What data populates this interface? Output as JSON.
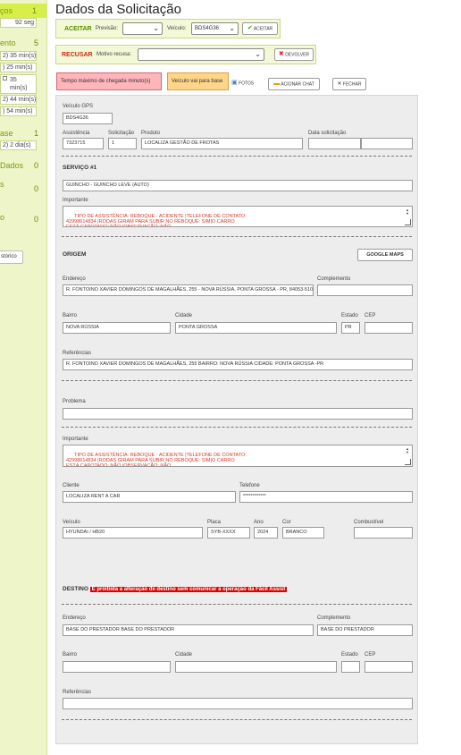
{
  "sidebar": {
    "rows": [
      {
        "title": "ços",
        "num": "1"
      },
      {
        "box": "92 seg"
      },
      {
        "title": "ento",
        "num": "5"
      },
      {
        "box": "2) 35 min(s)"
      },
      {
        "box": ") 25 min(s)"
      },
      {
        "box": "35 min(s)"
      },
      {
        "box": "2) 44 min(s)"
      },
      {
        "box": ") 54 min(s)"
      },
      {
        "title": "ase",
        "num": "1"
      },
      {
        "box": "2) 2 dia(s)"
      },
      {
        "title": "Dados",
        "num": "0"
      },
      {
        "title": "s",
        "num": "0"
      },
      {
        "title": "o",
        "num": "0"
      }
    ],
    "history_button": "stórico"
  },
  "page_title": "Dados da Solicitação",
  "accept_bar": {
    "accept_label": "ACEITAR",
    "forecast_label": "Previsão:",
    "forecast_value": "",
    "vehicle_label": "Veículo:",
    "vehicle_value": "BDS4G36",
    "accept_button": "ACEITAR"
  },
  "refuse_bar": {
    "refuse_label": "RECUSAR",
    "reason_label": "Motivo recusa:",
    "reason_value": "",
    "return_button": "DEVOLVER"
  },
  "tags": {
    "max_time": "Tempo máximo de chegada minuto(s)",
    "vehicle_base": "Veículo vai para base"
  },
  "buttons": {
    "photos": "FOTOS",
    "chat": "ACIONAR CHAT",
    "close": "FECHAR",
    "maps": "GOOGLE MAPS"
  },
  "form": {
    "gps_vehicle_label": "Veículo GPS",
    "gps_vehicle_value": "BDS4G36",
    "assistance_label": "Assistência",
    "assistance_value": "7323715",
    "request_label": "Solicitação",
    "request_value": "1",
    "product_label": "Produto",
    "product_value": "LOCALIZA GESTÃO DE FROTAS",
    "request_date_label": "Data solicitação",
    "request_date_value": "",
    "service_title": "SERVIÇO #1",
    "service_value": "GUINCHO - GUINCHO LEVE (AUTO)",
    "important_label": "Importante",
    "important_text": "TIPO DE ASSISTÊNCIA: REBOQUE - ACIDENTE |TELEFONE DE CONTATO:\n42998614834 |RODAS GIRAM PARA SUBIR NO REBOQUE: SIM|O CARRO\nESTÁ CAPOTADO: NÃO |OBSERVAÇÃO: NÃO",
    "origin_title": "ORIGEM",
    "address_label": "Endereço",
    "origin_address": "R. FONTOINO XAVIER DOMINGOS DE MAGALHÃES, 255 - NOVA RÚSSIA, PONTA GROSSA - PR, 84053-510",
    "complement_label": "Complemento",
    "origin_complement": "",
    "district_label": "Bairro",
    "origin_district": "NOVA RÚSSIA",
    "city_label": "Cidade",
    "origin_city": "PONTA GROSSA",
    "state_label": "Estado",
    "origin_state": "PR",
    "zip_label": "CEP",
    "origin_zip": "",
    "references_label": "Referências",
    "origin_references": "R. FONTOINO XAVIER DOMINGOS DE MAGALHÃES, 255 BAIRRO: NOVA RÚSSIA CIDADE: PONTA GROSSA -PR",
    "problem_label": "Problema",
    "problem_value": "",
    "important2_label": "Importante",
    "important2_text": "TIPO DE ASSISTÊNCIA: REBOQUE - ACIDENTE |TELEFONE DE CONTATO:\n42998614834 |RODAS GIRAM PARA SUBIR NO REBOQUE: SIM|O CARRO\nESTÁ CAPOTADO: NÃO |OBSERVAÇÃO: NÃO",
    "client_label": "Cliente",
    "client_value": "LOCALIZA RENT A CAR",
    "phone_label": "Telefone",
    "phone_value": "************",
    "vehicle_label": "Veículo",
    "vehicle_value": "HYUNDAI / HB20",
    "plate_label": "Placa",
    "plate_value": "SYB-XXXX",
    "year_label": "Ano",
    "year_value": "2024",
    "color_label": "Cor",
    "color_value": "BRANCO",
    "fuel_label": "Combustível",
    "fuel_value": "",
    "destination_title": "DESTINO",
    "destination_warning": "É proibida a alteração de destino sem comunicar a operação da Fácil Assist",
    "dest_address": "BASE DO PRESTADOR BASE DO PRESTADOR",
    "dest_complement": "BASE DO PRESTADOR",
    "dest_district": "",
    "dest_city": "",
    "dest_state": "",
    "dest_zip": "",
    "dest_references": ""
  }
}
